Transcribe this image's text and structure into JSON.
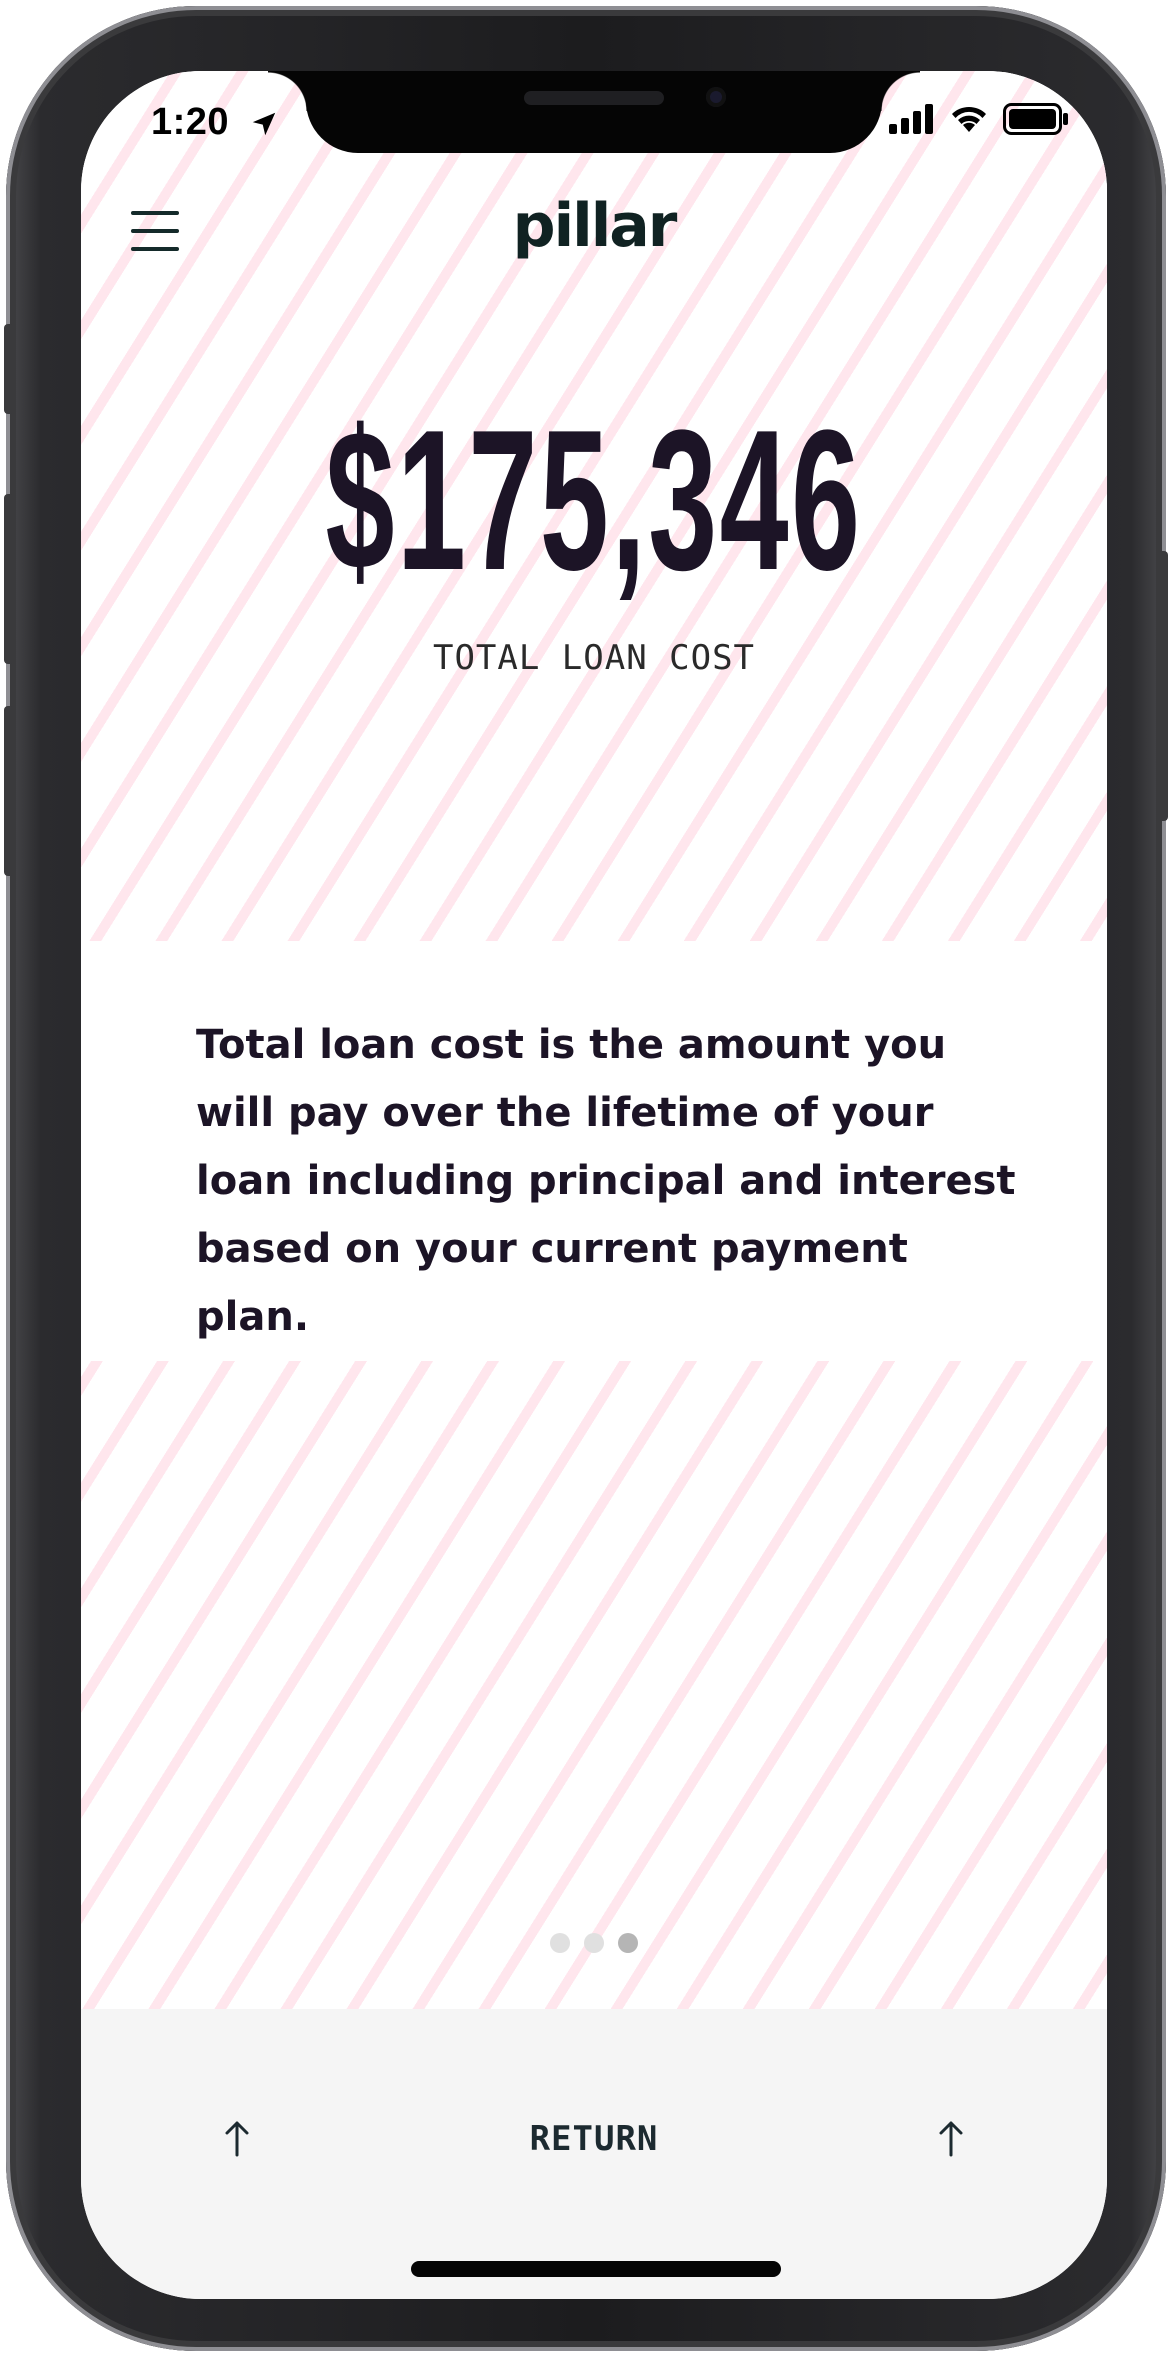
{
  "status_bar": {
    "time": "1:20",
    "icons": [
      "location-arrow-icon",
      "cellular-signal-icon",
      "wifi-icon",
      "battery-icon"
    ]
  },
  "header": {
    "logo": "pillar",
    "menu_icon": "hamburger-menu-icon"
  },
  "summary": {
    "amount": "$175,346",
    "label": "TOTAL LOAN COST"
  },
  "description": "Total loan cost is the amount you will pay over the lifetime of your loan including principal and interest based on your current payment plan.",
  "pagination": {
    "total": 3,
    "active_index": 2
  },
  "footer": {
    "return_label": "RETURN",
    "left_icon": "up-arrow-icon",
    "right_icon": "up-arrow-icon"
  },
  "colors": {
    "primary_text": "#1c1426",
    "pattern_pink": "#ffb6cb",
    "footer_bg": "#f5f5f5"
  }
}
